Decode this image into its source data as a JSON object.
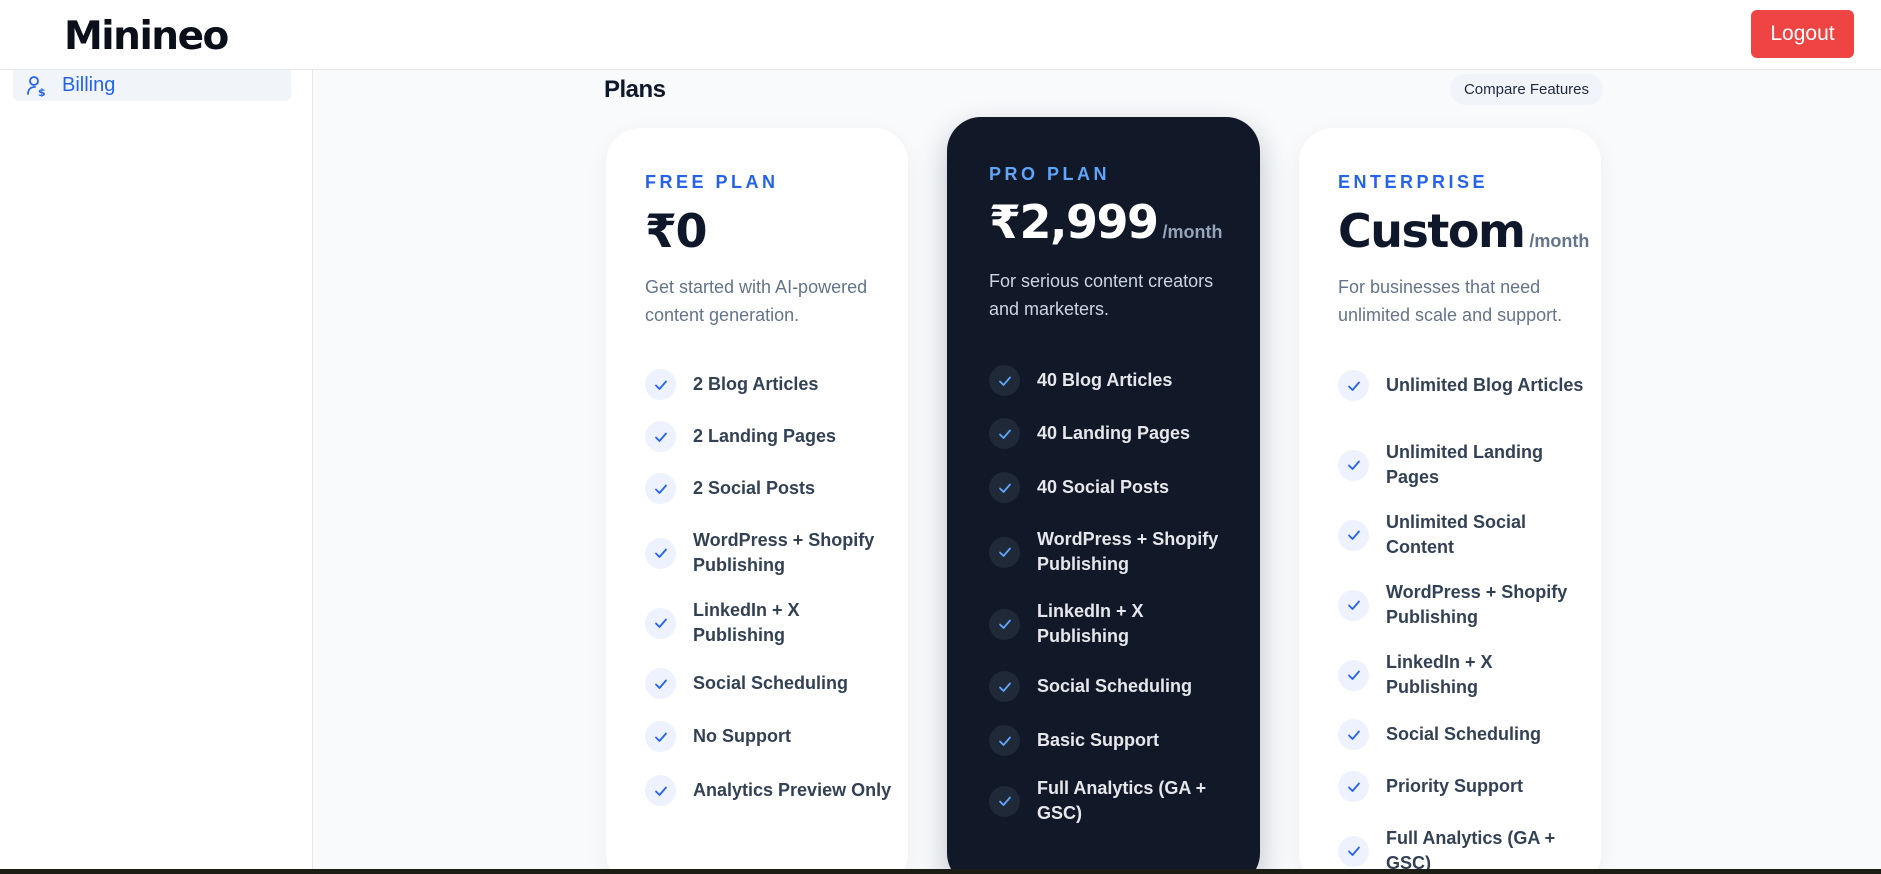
{
  "header": {
    "logo_text": "Minineo",
    "logout_label": "Logout"
  },
  "sidebar": {
    "items": [
      {
        "label": "Billing",
        "icon": "billing-user-icon",
        "active": true
      }
    ]
  },
  "plans": {
    "title": "Plans",
    "compare_label": "Compare Features",
    "cards": [
      {
        "name": "FREE PLAN",
        "price": "₹0",
        "period": "",
        "description": "Get started with AI-powered content generation.",
        "features": [
          "2 Blog Articles",
          "2 Landing Pages",
          "2 Social Posts",
          "WordPress + Shopify Publishing",
          "LinkedIn + X Publishing",
          "Social Scheduling",
          "No Support",
          "Analytics Preview Only"
        ]
      },
      {
        "name": "PRO PLAN",
        "price": "₹2,999",
        "period": "/month",
        "description": "For serious content creators and marketers.",
        "features": [
          "40 Blog Articles",
          "40 Landing Pages",
          "40 Social Posts",
          "WordPress + Shopify Publishing",
          "LinkedIn + X Publishing",
          "Social Scheduling",
          "Basic Support",
          "Full Analytics (GA + GSC)"
        ]
      },
      {
        "name": "ENTERPRISE",
        "price": "Custom",
        "period": "/month",
        "description": "For businesses that need unlimited scale and support.",
        "features": [
          "Unlimited Blog Articles",
          "Unlimited Landing Pages",
          "Unlimited Social Content",
          "WordPress + Shopify Publishing",
          "LinkedIn + X Publishing",
          "Social Scheduling",
          "Priority Support",
          "Full Analytics (GA + GSC)"
        ]
      }
    ]
  },
  "colors": {
    "accent": "#2563eb",
    "logout": "#ef4444",
    "pro_card_bg": "#111827"
  }
}
